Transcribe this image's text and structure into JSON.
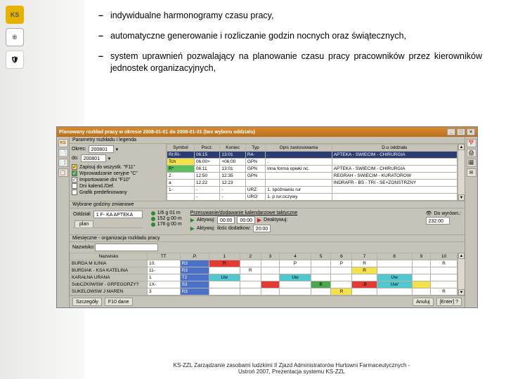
{
  "bullets": [
    "indywidualne harmonogramy czasu pracy,",
    "automatyczne generowanie i rozliczanie godzin nocnych oraz świątecznych,",
    "system uprawnień pozwalający na planowanie czasu pracy pracowników przez kierowników jednostek organizacyjnych,"
  ],
  "window": {
    "title": "Planowany rozkład pracy w okresie 2008-01-01 do 2008-01-31 (bez wyboru oddziału)",
    "buttons": {
      "min": "_",
      "max": "□",
      "close": "×"
    }
  },
  "left_icons": [
    "KS",
    "📄",
    "📑",
    "📋"
  ],
  "right_icons": [
    "📅",
    "🖨",
    "🗓",
    "✉"
  ],
  "param": {
    "section": "Parametry rozkładu i legenda",
    "year_label": "Okres:",
    "year": "200801",
    "to_label": "do:",
    "year_to": "200801",
    "checks": [
      {
        "color": "yellow",
        "label": "Zapisuj do wszystk. \"F11\""
      },
      {
        "color": "green",
        "label": "Wprowadzanie seryjne \"C\""
      },
      {
        "color": "white",
        "label": "Importowanie dni \"F10\""
      },
      {
        "label": "Dni kalend./Def."
      },
      {
        "label": "Grafik predefiniowany"
      }
    ]
  },
  "shifts": {
    "headers": [
      "Symbol",
      "Pocz.",
      "Koniec",
      "Typ",
      "Opis zastosowania",
      "D.u oddziału"
    ],
    "rows": [
      {
        "sym": "RI:RI-",
        "p": "06:15",
        "k": "13:01",
        "t": "R4-",
        "o": ".",
        "d": "APTEKA - SWIECIM - CHIRURGIA",
        "sel": true
      },
      {
        "sym": "Tch",
        "p": "06:00+",
        "k": "+06:00",
        "t": "GPN",
        "o": ".",
        "d": ""
      },
      {
        "sym": "R*",
        "p": "06:11",
        "k": "13:01",
        "t": "GPN",
        "o": "inna forma opieki nc.",
        "d": "APTEKA - SWIECIM - CHIRURGIA"
      },
      {
        "sym": "2",
        "p": "12:50",
        "k": "12:35",
        "t": "GPN",
        "o": "",
        "d": "REGRAH - SWIECIM - KURATOROW"
      },
      {
        "sym": "a",
        "p": "12:22",
        "k": "12:23",
        "t": "",
        "o": "",
        "d": "INDRAFR - BS - TRI - SE+ZONSTRZNY"
      },
      {
        "sym": "1-",
        "p": "-",
        "k": "-",
        "t": "URZ",
        "o": "1. śpóźnianiu rur",
        "d": ""
      },
      {
        "sym": "",
        "p": "-",
        "k": "-",
        "t": "URO",
        "o": "1. p rur.oczywy",
        "d": ""
      }
    ]
  },
  "tabs": {
    "plan": "plan"
  },
  "selected": {
    "section": "Wybrane godziny zmianowe",
    "dept_label": "Oddział:",
    "dept_value": "1 F- KA APTEKA",
    "rows": [
      {
        "icon": "green",
        "text": "1/6 g 01 m"
      },
      {
        "icon": "green",
        "text": "152 g 00 m"
      },
      {
        "icon": "green",
        "text": "176 g 00 m"
      }
    ],
    "act_label": "Przesuwanie/dodawanie kalendarzowe taktyczne",
    "activate1": "Aktywuj:",
    "activate2": "Aktywuj:",
    "val1": "00:00",
    "val2": "00:00",
    "val3": "00:00",
    "extra_label": "ilośc dodatkow:",
    "extra_val": "20:00",
    "deactivate": "Deaktywuj:",
    "summary_label": "Do wyrówn.:",
    "summary_val": "232:00",
    "eye": "👁"
  },
  "schedule": {
    "section": "Miesięczne - organizacja rozkładu pracy",
    "section2": "Nazwisko:",
    "headers": [
      "Nazwisko",
      "TT",
      ".P.",
      "1",
      "2",
      "3",
      "4",
      "5",
      "6",
      "7",
      "8",
      "9",
      "10"
    ],
    "rows": [
      {
        "name": "BURDA M ILINIA",
        "tt": "10.",
        "p": "R3",
        "cells": [
          "R",
          "",
          "",
          "P",
          "",
          "P",
          "R",
          "",
          "",
          "R"
        ],
        "colors": [
          "sc-red",
          "sc-white",
          "sc-white",
          "sc-white",
          "sc-white",
          "sc-white",
          "sc-white",
          "sc-white",
          "sc-white",
          "sc-white"
        ]
      },
      {
        "name": "BURDIAK - KSA KATELINA",
        "tt": "11-",
        "p": "R3",
        "cells": [
          "",
          "R",
          "",
          "",
          "",
          "",
          "R",
          "",
          "",
          ""
        ],
        "colors": [
          "sc-white",
          "sc-white",
          "sc-white",
          "sc-white",
          "sc-white",
          "sc-white",
          "sc-yellow",
          "sc-white",
          "sc-white",
          "sc-white"
        ]
      },
      {
        "name": "KARAŁNA URANA",
        "tt": "1",
        "p": "T2",
        "cells": [
          "Uw",
          "",
          "",
          "Uw",
          "",
          "",
          "",
          "Uw",
          "",
          ""
        ],
        "colors": [
          "sc-cyan",
          "sc-white",
          "sc-white",
          "sc-cyan",
          "sc-white",
          "sc-white",
          "sc-white",
          "sc-cyan",
          "sc-white",
          "sc-white"
        ]
      },
      {
        "name": "SobCZK0WSW - GRFEGORZY?",
        "tt": "1X-",
        "p": "S3",
        "cells": [
          "",
          "",
          "",
          "",
          "B",
          "",
          "-B",
          "Uw/",
          "",
          ""
        ],
        "colors": [
          "sc-white",
          "sc-white",
          "sc-red",
          "sc-white",
          "sc-green",
          "sc-white",
          "sc-red",
          "sc-cyan",
          "sc-yellow",
          "sc-white"
        ]
      },
      {
        "name": "SUKELOWSW J MAREN",
        "tt": "3",
        "p": "R3",
        "cells": [
          "",
          "",
          "",
          "",
          "",
          "R",
          "",
          "",
          "",
          "R"
        ],
        "colors": [
          "sc-white",
          "sc-white",
          "sc-white",
          "sc-white",
          "sc-white",
          "sc-yellow",
          "sc-white",
          "sc-white",
          "sc-white",
          "sc-white"
        ]
      }
    ]
  },
  "bottom": {
    "btn1": "Szczegóły",
    "btn2": "F10 dane",
    "btn_cancel": "Anuluj",
    "btn_close": "[Enter] ?"
  },
  "footer": {
    "line1": "KS-ZZL Zarządzanie zasobami ludzkimi II Zjazd Administratorów Hurtowni Farmaceutycznych -",
    "line2": "Ustroń 2007, Prezentacja systemu KS-ZZL"
  }
}
